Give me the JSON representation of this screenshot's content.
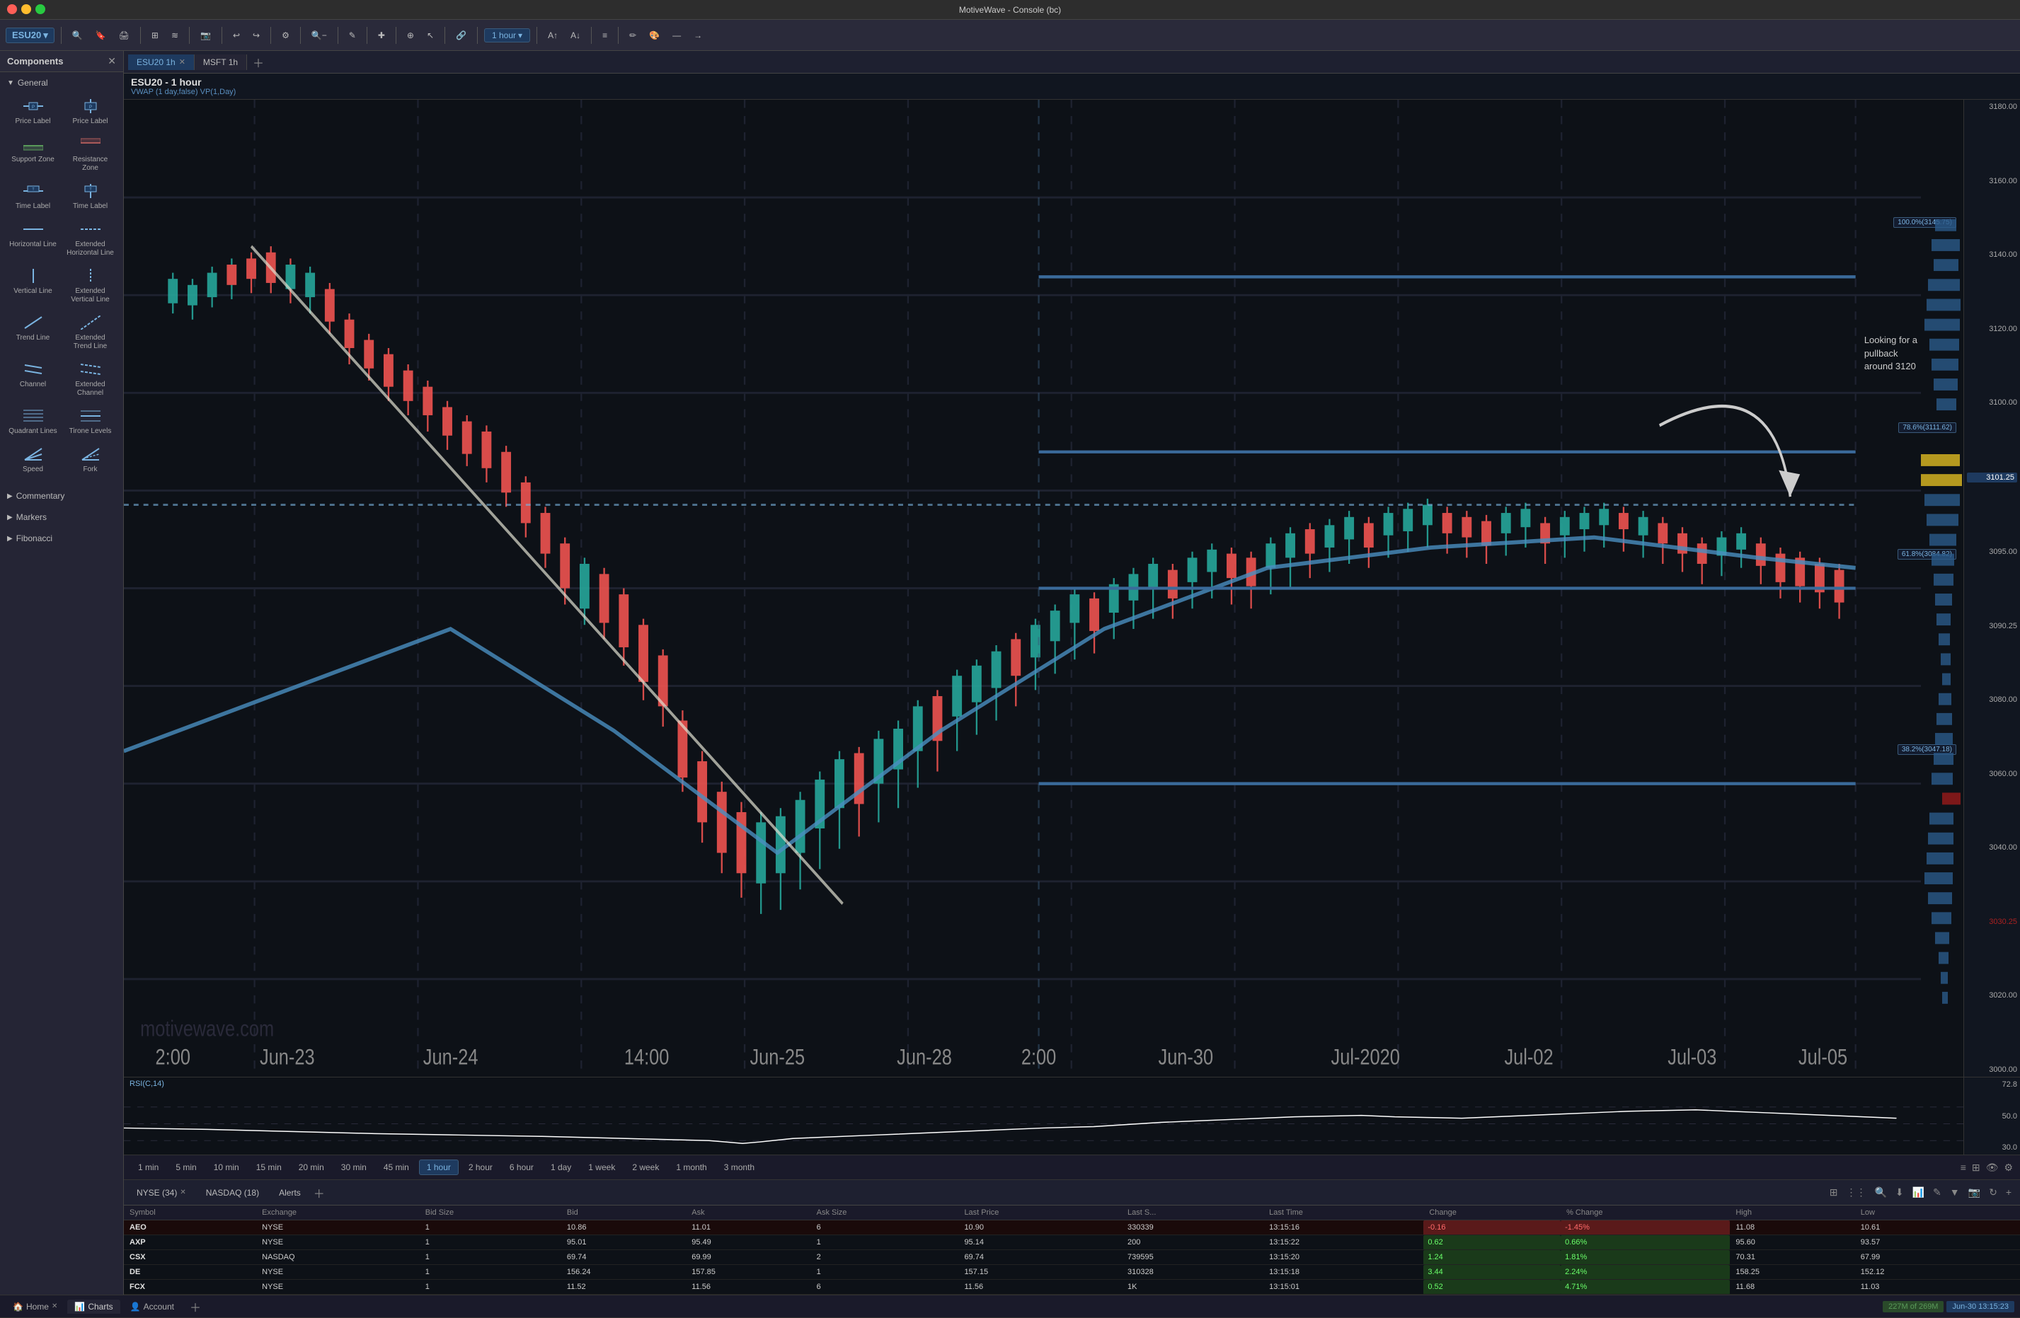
{
  "app": {
    "title": "MotiveWave - Console (bc)",
    "version": "MotiveWave"
  },
  "traffic_lights": [
    "red",
    "yellow",
    "green"
  ],
  "toolbar": {
    "symbol": "ESU20",
    "timeframe": "1 hour",
    "tools": [
      "pointer",
      "crosshair",
      "zoom",
      "draw",
      "text",
      "measure"
    ]
  },
  "tabs": [
    {
      "label": "ESU20 1h",
      "active": true
    },
    {
      "label": "MSFT 1h",
      "active": false
    }
  ],
  "chart": {
    "title": "ESU20 - 1 hour",
    "subtitle": "VWAP (1 day,false)  VP(1,Day)",
    "watermark": "motivewave.com",
    "annotation": {
      "text": "Looking for a\npullback\naround 3120"
    },
    "fib_levels": [
      {
        "label": "100.0%(3145.75)",
        "pct": 100
      },
      {
        "label": "78.6%(3111.62)",
        "pct": 78.6
      },
      {
        "label": "61.8%(3084.82)",
        "pct": 61.8
      },
      {
        "label": "38.2%(3047.18)",
        "pct": 38.2
      }
    ],
    "price_scale": {
      "levels": [
        "3180.00",
        "3160.00",
        "3140.00",
        "3120.00",
        "3100.00",
        "3080.00",
        "3060.00",
        "3040.00",
        "3020.00",
        "3000.00"
      ]
    },
    "current_price": "3101.25",
    "price_levels_right": [
      "3101.25",
      "3095.00",
      "3090.25"
    ],
    "xaxis_labels": [
      "2:00",
      "Jun-23",
      "Jun-24",
      "14:00",
      "Jun-25",
      "Jun-28",
      "2:00",
      "Jun-30",
      "Jul-2020",
      "Jul-02",
      "Jul-03",
      "Jul-05"
    ]
  },
  "rsi": {
    "label": "RSI(C,14)",
    "levels": [
      "72.8",
      "50.0",
      "30.0"
    ]
  },
  "timeframes": [
    {
      "label": "1 min",
      "active": false
    },
    {
      "label": "5 min",
      "active": false
    },
    {
      "label": "10 min",
      "active": false
    },
    {
      "label": "15 min",
      "active": false
    },
    {
      "label": "20 min",
      "active": false
    },
    {
      "label": "30 min",
      "active": false
    },
    {
      "label": "45 min",
      "active": false
    },
    {
      "label": "1 hour",
      "active": true
    },
    {
      "label": "2 hour",
      "active": false
    },
    {
      "label": "6 hour",
      "active": false
    },
    {
      "label": "1 day",
      "active": false
    },
    {
      "label": "1 week",
      "active": false
    },
    {
      "label": "2 week",
      "active": false
    },
    {
      "label": "1 month",
      "active": false
    },
    {
      "label": "3 month",
      "active": false
    }
  ],
  "watchlist": {
    "tabs": [
      {
        "label": "NYSE (34)",
        "closable": true
      },
      {
        "label": "NASDAQ (18)",
        "closable": false
      },
      {
        "label": "Alerts",
        "closable": false
      }
    ],
    "columns": [
      "Symbol",
      "Exchange",
      "Bid Size",
      "Bid",
      "Ask",
      "Ask Size",
      "Last Price",
      "Last S...",
      "Last Time",
      "Change",
      "% Change",
      "High",
      "Low"
    ],
    "rows": [
      {
        "symbol": "AEO",
        "exchange": "NYSE",
        "bid_size": "1",
        "bid": "10.86",
        "ask": "11.01",
        "ask_size": "6",
        "last_price": "10.90",
        "last_s": "330339",
        "last_time": "13:15:16",
        "change": "-0.16",
        "pct_change": "-1.45%",
        "high": "11.08",
        "low": "10.61",
        "change_type": "negative"
      },
      {
        "symbol": "AXP",
        "exchange": "NYSE",
        "bid_size": "1",
        "bid": "95.01",
        "ask": "95.49",
        "ask_size": "1",
        "last_price": "95.14",
        "last_s": "200",
        "last_time": "13:15:22",
        "change": "0.62",
        "pct_change": "0.66%",
        "high": "95.60",
        "low": "93.57",
        "change_type": "positive"
      },
      {
        "symbol": "CSX",
        "exchange": "NASDAQ",
        "bid_size": "1",
        "bid": "69.74",
        "ask": "69.99",
        "ask_size": "2",
        "last_price": "69.74",
        "last_s": "739595",
        "last_time": "13:15:20",
        "change": "1.24",
        "pct_change": "1.81%",
        "high": "70.31",
        "low": "67.99",
        "change_type": "positive"
      },
      {
        "symbol": "DE",
        "exchange": "NYSE",
        "bid_size": "1",
        "bid": "156.24",
        "ask": "157.85",
        "ask_size": "1",
        "last_price": "157.15",
        "last_s": "310328",
        "last_time": "13:15:18",
        "change": "3.44",
        "pct_change": "2.24%",
        "high": "158.25",
        "low": "152.12",
        "change_type": "positive"
      },
      {
        "symbol": "FCX",
        "exchange": "NYSE",
        "bid_size": "1",
        "bid": "11.52",
        "ask": "11.56",
        "ask_size": "6",
        "last_price": "11.56",
        "last_s": "1K",
        "last_time": "13:15:01",
        "change": "0.52",
        "pct_change": "4.71%",
        "high": "11.68",
        "low": "11.03",
        "change_type": "positive"
      }
    ]
  },
  "sidebar": {
    "title": "Components",
    "sections": [
      {
        "label": "General",
        "items": [
          {
            "label": "Price Label",
            "icon": "price-label-h"
          },
          {
            "label": "Price Label",
            "icon": "price-label-v"
          },
          {
            "label": "Support Zone",
            "icon": "support-zone"
          },
          {
            "label": "Resistance Zone",
            "icon": "resistance-zone"
          },
          {
            "label": "Time Label",
            "icon": "time-label-h"
          },
          {
            "label": "Time Label",
            "icon": "time-label-v"
          },
          {
            "label": "Horizontal Line",
            "icon": "h-line"
          },
          {
            "label": "Extended Horizontal Line",
            "icon": "ext-h-line"
          },
          {
            "label": "Vertical Line",
            "icon": "v-line"
          },
          {
            "label": "Extended Vertical Line",
            "icon": "ext-v-line"
          },
          {
            "label": "Trend Line",
            "icon": "trend-line"
          },
          {
            "label": "Extended Trend Line",
            "icon": "ext-trend-line"
          },
          {
            "label": "Channel",
            "icon": "channel"
          },
          {
            "label": "Extended Channel",
            "icon": "ext-channel"
          },
          {
            "label": "Quadrant Lines",
            "icon": "quadrant"
          },
          {
            "label": "Tirone Levels",
            "icon": "tirone"
          },
          {
            "label": "Speed",
            "icon": "speed"
          },
          {
            "label": "Fork",
            "icon": "fork"
          }
        ]
      },
      {
        "label": "Commentary",
        "collapsed": true
      },
      {
        "label": "Markers",
        "collapsed": true
      },
      {
        "label": "Fibonacci",
        "collapsed": true
      }
    ]
  },
  "bottom_tabs": [
    {
      "label": "Home",
      "active": false,
      "closable": true,
      "icon": "home"
    },
    {
      "label": "Charts",
      "active": true,
      "closable": false,
      "icon": "charts"
    },
    {
      "label": "Account",
      "active": false,
      "closable": false,
      "icon": "account"
    }
  ],
  "status_bar": {
    "memory": "227M of 269M",
    "datetime": "Jun-30 13:15:23"
  },
  "colors": {
    "accent_blue": "#1e3a5f",
    "text_blue": "#7ab3e0",
    "bg_dark": "#0d1117",
    "bg_panel": "#1a1a2a",
    "positive": "#2a6a2a",
    "negative": "#6a1a1a",
    "candle_up": "#26a69a",
    "candle_down": "#ef5350",
    "fib_line": "#3a6a9a"
  }
}
